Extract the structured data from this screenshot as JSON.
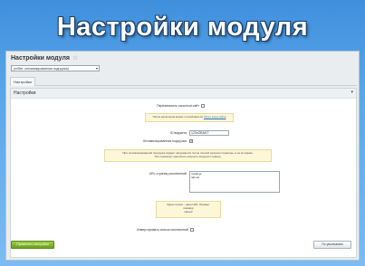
{
  "banner": {
    "title": "Настройки модуля"
  },
  "window": {
    "title": "Настройки модуля",
    "star": "☆",
    "site_select": "(mSite: оптимизированная подгрузка)"
  },
  "tabs": [
    {
      "label": "Настройки"
    }
  ],
  "section": {
    "title": "Настройки",
    "collapse_icon": "chevron-down-icon"
  },
  "fields": {
    "override_label": "Перезаписать canonical-сайт",
    "override_checked": false,
    "hint_1_text": "После включения может потребоваться",
    "hint_1_link": "сброс кэша сайта",
    "widget_id_label": "ID виджета",
    "widget_id_value": "123xOBAKT",
    "optimized_label": "Оптимизированная подгрузка",
    "optimized_checked": true,
    "hint_2_line1": "При оптимизированной подгрузке виджет загружается после полной загрузки страницы, а не во время.",
    "hint_2_line2": "Это позволяет увеличить скорость загрузки страниц.",
    "urls_label": "URL страниц исключений",
    "urls_value": "/catalog/\n/about/",
    "hint_3_line1": "Одна строка – один URL. Пример:",
    "hint_3_line2": "/catalog/",
    "hint_3_line3": "/about/",
    "invert_label": "Инвертировать список исключений",
    "invert_checked": false
  },
  "buttons": {
    "apply": "Применить настройки",
    "default": "По умолчанию"
  },
  "colors": {
    "background": "#4a9be4",
    "apply_button": "#86b82c",
    "hint_bg": "#fdf7d8"
  }
}
